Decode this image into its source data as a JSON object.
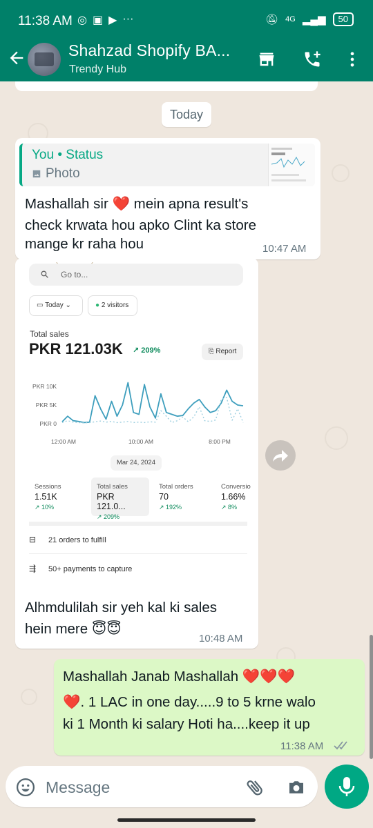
{
  "status_bar": {
    "time": "11:38 AM",
    "network": "4G",
    "battery": "50"
  },
  "header": {
    "chat_name": "Shahzad Shopify BA...",
    "subtitle": "Trendy Hub"
  },
  "date_separator": "Today",
  "messages": {
    "m1": {
      "quote_title": "You • Status",
      "quote_type": "Photo",
      "line1": "Mashallah sir ❤️ mein apna result's",
      "line2": "check krwata hou apko Clint ka store",
      "line3": "mange kr raha hou",
      "time": "10:47 AM"
    },
    "m2": {
      "caption_line1": "Alhmdulilah sir yeh kal ki sales",
      "caption_line2": "hein mere 😇😇",
      "time": "10:48 AM"
    },
    "m3": {
      "line1": "Mashallah Janab Mashallah ❤️❤️❤️",
      "line2": "❤️.  1 LAC in one day.....9 to 5 krne walo",
      "line3": "ki 1 Month ki salary Hoti ha....keep it up",
      "time": "11:38 AM"
    }
  },
  "screenshot": {
    "search_placeholder": "Go to...",
    "date_filter": "Today",
    "visitors": "2 visitors",
    "total_sales_label": "Total sales",
    "total_sales_value": "PKR 121.03K",
    "total_sales_change": "↗ 209%",
    "report_label": "Report",
    "date_label": "Mar 24, 2024",
    "metrics": [
      {
        "label": "Sessions",
        "value": "1.51K",
        "change": "↗ 10%"
      },
      {
        "label": "Total sales",
        "value": "PKR 121.0...",
        "change": "↗ 209%"
      },
      {
        "label": "Total orders",
        "value": "70",
        "change": "↗ 192%"
      },
      {
        "label": "Conversio",
        "value": "1.66%",
        "change": "↗ 8%"
      }
    ],
    "orders_row": "21 orders to fulfill",
    "payments_row": "50+ payments to capture"
  },
  "chart_data": {
    "type": "line",
    "y_ticks": [
      "PKR 10K",
      "PKR 5K",
      "PKR 0"
    ],
    "x_ticks": [
      "12:00 AM",
      "10:00 AM",
      "8:00 PM"
    ],
    "ylim": [
      0,
      10000
    ],
    "series": [
      {
        "values": [
          500,
          2000,
          800,
          600,
          300,
          400,
          7500,
          4000,
          1200,
          6000,
          2000,
          5000,
          11000,
          3000,
          2500,
          10500,
          4500,
          1500,
          8000,
          3000,
          2500,
          2000,
          2200,
          4000,
          5500,
          6500,
          4500,
          3000,
          3500,
          5500,
          9000,
          6000,
          5000,
          4800
        ]
      },
      {
        "dashed": true,
        "values": [
          300,
          800,
          400,
          300,
          200,
          300,
          500,
          700,
          400,
          600,
          300,
          400,
          600,
          300,
          400,
          300,
          500,
          400,
          3500,
          2000,
          300,
          800,
          1800,
          500,
          1800,
          4500,
          800,
          600,
          1000,
          6500,
          7000,
          900,
          4000,
          300
        ]
      }
    ]
  },
  "composer": {
    "placeholder": "Message"
  }
}
